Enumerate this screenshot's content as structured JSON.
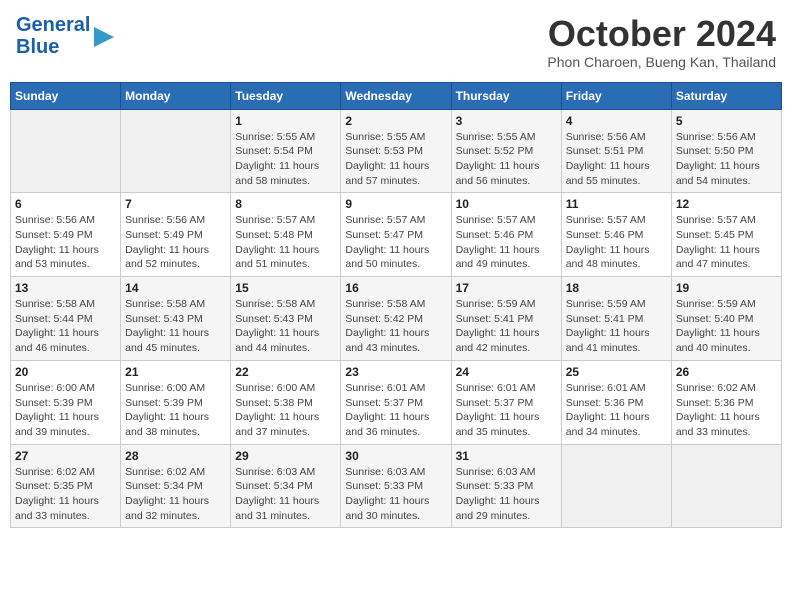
{
  "header": {
    "logo_line1": "General",
    "logo_line2": "Blue",
    "month_title": "October 2024",
    "subtitle": "Phon Charoen, Bueng Kan, Thailand"
  },
  "weekdays": [
    "Sunday",
    "Monday",
    "Tuesday",
    "Wednesday",
    "Thursday",
    "Friday",
    "Saturday"
  ],
  "weeks": [
    [
      {
        "day": "",
        "sunrise": "",
        "sunset": "",
        "daylight": ""
      },
      {
        "day": "",
        "sunrise": "",
        "sunset": "",
        "daylight": ""
      },
      {
        "day": "1",
        "sunrise": "Sunrise: 5:55 AM",
        "sunset": "Sunset: 5:54 PM",
        "daylight": "Daylight: 11 hours and 58 minutes."
      },
      {
        "day": "2",
        "sunrise": "Sunrise: 5:55 AM",
        "sunset": "Sunset: 5:53 PM",
        "daylight": "Daylight: 11 hours and 57 minutes."
      },
      {
        "day": "3",
        "sunrise": "Sunrise: 5:55 AM",
        "sunset": "Sunset: 5:52 PM",
        "daylight": "Daylight: 11 hours and 56 minutes."
      },
      {
        "day": "4",
        "sunrise": "Sunrise: 5:56 AM",
        "sunset": "Sunset: 5:51 PM",
        "daylight": "Daylight: 11 hours and 55 minutes."
      },
      {
        "day": "5",
        "sunrise": "Sunrise: 5:56 AM",
        "sunset": "Sunset: 5:50 PM",
        "daylight": "Daylight: 11 hours and 54 minutes."
      }
    ],
    [
      {
        "day": "6",
        "sunrise": "Sunrise: 5:56 AM",
        "sunset": "Sunset: 5:49 PM",
        "daylight": "Daylight: 11 hours and 53 minutes."
      },
      {
        "day": "7",
        "sunrise": "Sunrise: 5:56 AM",
        "sunset": "Sunset: 5:49 PM",
        "daylight": "Daylight: 11 hours and 52 minutes."
      },
      {
        "day": "8",
        "sunrise": "Sunrise: 5:57 AM",
        "sunset": "Sunset: 5:48 PM",
        "daylight": "Daylight: 11 hours and 51 minutes."
      },
      {
        "day": "9",
        "sunrise": "Sunrise: 5:57 AM",
        "sunset": "Sunset: 5:47 PM",
        "daylight": "Daylight: 11 hours and 50 minutes."
      },
      {
        "day": "10",
        "sunrise": "Sunrise: 5:57 AM",
        "sunset": "Sunset: 5:46 PM",
        "daylight": "Daylight: 11 hours and 49 minutes."
      },
      {
        "day": "11",
        "sunrise": "Sunrise: 5:57 AM",
        "sunset": "Sunset: 5:46 PM",
        "daylight": "Daylight: 11 hours and 48 minutes."
      },
      {
        "day": "12",
        "sunrise": "Sunrise: 5:57 AM",
        "sunset": "Sunset: 5:45 PM",
        "daylight": "Daylight: 11 hours and 47 minutes."
      }
    ],
    [
      {
        "day": "13",
        "sunrise": "Sunrise: 5:58 AM",
        "sunset": "Sunset: 5:44 PM",
        "daylight": "Daylight: 11 hours and 46 minutes."
      },
      {
        "day": "14",
        "sunrise": "Sunrise: 5:58 AM",
        "sunset": "Sunset: 5:43 PM",
        "daylight": "Daylight: 11 hours and 45 minutes."
      },
      {
        "day": "15",
        "sunrise": "Sunrise: 5:58 AM",
        "sunset": "Sunset: 5:43 PM",
        "daylight": "Daylight: 11 hours and 44 minutes."
      },
      {
        "day": "16",
        "sunrise": "Sunrise: 5:58 AM",
        "sunset": "Sunset: 5:42 PM",
        "daylight": "Daylight: 11 hours and 43 minutes."
      },
      {
        "day": "17",
        "sunrise": "Sunrise: 5:59 AM",
        "sunset": "Sunset: 5:41 PM",
        "daylight": "Daylight: 11 hours and 42 minutes."
      },
      {
        "day": "18",
        "sunrise": "Sunrise: 5:59 AM",
        "sunset": "Sunset: 5:41 PM",
        "daylight": "Daylight: 11 hours and 41 minutes."
      },
      {
        "day": "19",
        "sunrise": "Sunrise: 5:59 AM",
        "sunset": "Sunset: 5:40 PM",
        "daylight": "Daylight: 11 hours and 40 minutes."
      }
    ],
    [
      {
        "day": "20",
        "sunrise": "Sunrise: 6:00 AM",
        "sunset": "Sunset: 5:39 PM",
        "daylight": "Daylight: 11 hours and 39 minutes."
      },
      {
        "day": "21",
        "sunrise": "Sunrise: 6:00 AM",
        "sunset": "Sunset: 5:39 PM",
        "daylight": "Daylight: 11 hours and 38 minutes."
      },
      {
        "day": "22",
        "sunrise": "Sunrise: 6:00 AM",
        "sunset": "Sunset: 5:38 PM",
        "daylight": "Daylight: 11 hours and 37 minutes."
      },
      {
        "day": "23",
        "sunrise": "Sunrise: 6:01 AM",
        "sunset": "Sunset: 5:37 PM",
        "daylight": "Daylight: 11 hours and 36 minutes."
      },
      {
        "day": "24",
        "sunrise": "Sunrise: 6:01 AM",
        "sunset": "Sunset: 5:37 PM",
        "daylight": "Daylight: 11 hours and 35 minutes."
      },
      {
        "day": "25",
        "sunrise": "Sunrise: 6:01 AM",
        "sunset": "Sunset: 5:36 PM",
        "daylight": "Daylight: 11 hours and 34 minutes."
      },
      {
        "day": "26",
        "sunrise": "Sunrise: 6:02 AM",
        "sunset": "Sunset: 5:36 PM",
        "daylight": "Daylight: 11 hours and 33 minutes."
      }
    ],
    [
      {
        "day": "27",
        "sunrise": "Sunrise: 6:02 AM",
        "sunset": "Sunset: 5:35 PM",
        "daylight": "Daylight: 11 hours and 33 minutes."
      },
      {
        "day": "28",
        "sunrise": "Sunrise: 6:02 AM",
        "sunset": "Sunset: 5:34 PM",
        "daylight": "Daylight: 11 hours and 32 minutes."
      },
      {
        "day": "29",
        "sunrise": "Sunrise: 6:03 AM",
        "sunset": "Sunset: 5:34 PM",
        "daylight": "Daylight: 11 hours and 31 minutes."
      },
      {
        "day": "30",
        "sunrise": "Sunrise: 6:03 AM",
        "sunset": "Sunset: 5:33 PM",
        "daylight": "Daylight: 11 hours and 30 minutes."
      },
      {
        "day": "31",
        "sunrise": "Sunrise: 6:03 AM",
        "sunset": "Sunset: 5:33 PM",
        "daylight": "Daylight: 11 hours and 29 minutes."
      },
      {
        "day": "",
        "sunrise": "",
        "sunset": "",
        "daylight": ""
      },
      {
        "day": "",
        "sunrise": "",
        "sunset": "",
        "daylight": ""
      }
    ]
  ]
}
